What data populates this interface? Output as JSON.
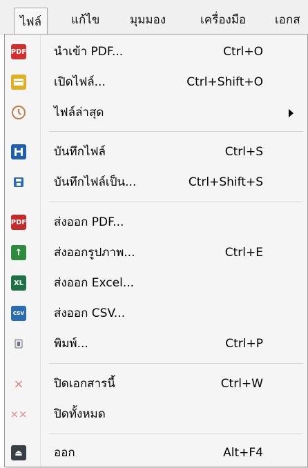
{
  "menubar": {
    "items": [
      "ไฟล์",
      "แก้ไข",
      "มุมมอง",
      "เครื่องมือ",
      "เอกส"
    ]
  },
  "menu": {
    "items": [
      {
        "label": "นำเข้า PDF...",
        "shortcut": "Ctrl+O",
        "icon": "pdf-icon",
        "icon_text": "PDF",
        "color": "#d32f2f"
      },
      {
        "label": "เปิดไฟล์...",
        "shortcut": "Ctrl+Shift+O",
        "icon": "folder-icon",
        "icon_text": "",
        "color": "#e0b021"
      },
      {
        "label": "ไฟล์ล่าสุด",
        "shortcut": "",
        "icon": "clock-icon",
        "icon_text": "",
        "color": "#c77a47"
      },
      {
        "label": "บันทึกไฟล์",
        "shortcut": "Ctrl+S",
        "icon": "save-icon",
        "icon_text": "",
        "color": "#1e5fb4"
      },
      {
        "label": "บันทึกไฟล์เป็น...",
        "shortcut": "Ctrl+Shift+S",
        "icon": "save-as-icon",
        "icon_text": "",
        "color": "#2a6bc0"
      },
      {
        "label": "ส่งออก PDF...",
        "shortcut": "",
        "icon": "pdf-export-icon",
        "icon_text": "PDF",
        "color": "#c62828"
      },
      {
        "label": "ส่งออกรูปภาพ...",
        "shortcut": "Ctrl+E",
        "icon": "image-export-icon",
        "icon_text": "↑",
        "color": "#2e8b3e"
      },
      {
        "label": "ส่งออก Excel...",
        "shortcut": "",
        "icon": "excel-icon",
        "icon_text": "XL",
        "color": "#1e7145"
      },
      {
        "label": "ส่งออก CSV...",
        "shortcut": "",
        "icon": "csv-icon",
        "icon_text": "csv",
        "color": "#2b6cb0"
      },
      {
        "label": "พิมพ์...",
        "shortcut": "Ctrl+P",
        "icon": "print-icon",
        "icon_text": "",
        "color": "#6d7580"
      },
      {
        "label": "ปิดเอกสารนี้",
        "shortcut": "Ctrl+W",
        "icon": "close-icon",
        "icon_text": "×",
        "color": "#e08585"
      },
      {
        "label": "ปิดทั้งหมด",
        "shortcut": "",
        "icon": "close-all-icon",
        "icon_text": "××",
        "color": "#e08585"
      },
      {
        "label": "ออก",
        "shortcut": "Alt+F4",
        "icon": "exit-icon",
        "icon_text": "⏏",
        "color": "#3a3f45"
      }
    ]
  }
}
